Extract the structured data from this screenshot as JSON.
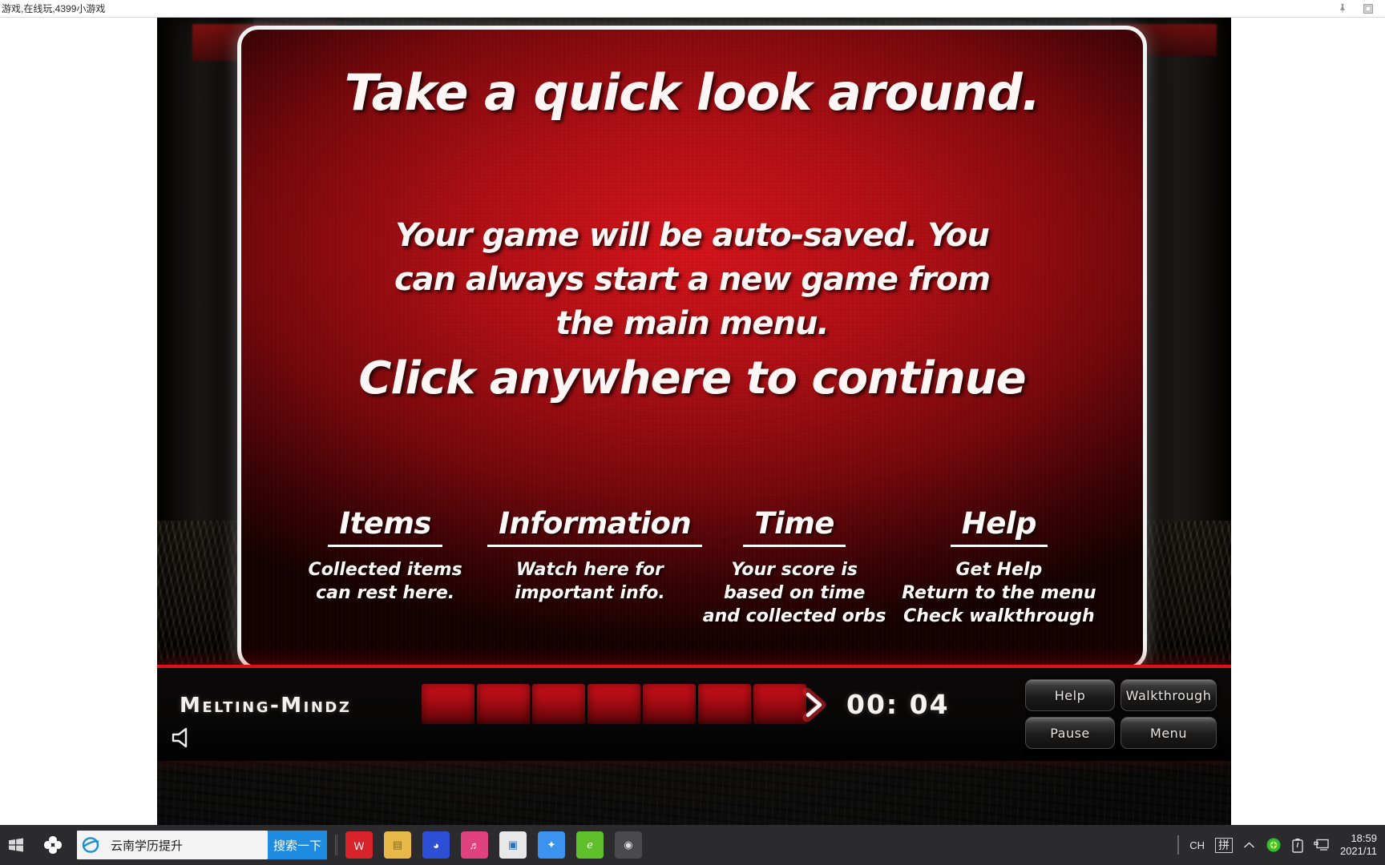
{
  "browser": {
    "title": "游戏,在线玩,4399小游戏",
    "pin_icon": "pin-icon",
    "restore_icon": "restore-icon"
  },
  "dialog": {
    "title": "Take a quick look around.",
    "body": "Your game will be auto-saved. You can always start a new game from the main menu.",
    "cta": "Click anywhere to continue",
    "callouts": [
      {
        "heading": "Items",
        "desc": "Collected items\ncan rest here."
      },
      {
        "heading": "Information",
        "desc": "Watch here for\nimportant info."
      },
      {
        "heading": "Time",
        "desc": "Your score is\nbased on time\nand collected orbs"
      },
      {
        "heading": "Help",
        "desc": "Get Help\nReturn to the menu\nCheck walkthrough"
      }
    ]
  },
  "hud": {
    "logo": "Melting-Mindz",
    "speaker_icon": "speaker-icon",
    "next_arrow_icon": "chevron-right-icon",
    "timer": "00: 04",
    "inventory_slots": 7,
    "buttons": [
      {
        "label": "Help"
      },
      {
        "label": "Walkthrough"
      },
      {
        "label": "Pause"
      },
      {
        "label": "Menu"
      }
    ],
    "accent_color": "#e01018"
  },
  "taskbar": {
    "start_icon": "windows-start-icon",
    "cortana_icon": "cortana-circle-icon",
    "search": {
      "engine_icon": "internet-explorer-icon",
      "value": "云南学历提升",
      "button_label": "搜索一下"
    },
    "apps": [
      {
        "name": "wps-office-icon",
        "glyph": "Ｗ",
        "color": "#d9232b",
        "active": false
      },
      {
        "name": "file-explorer-icon",
        "glyph": "▤",
        "color": "#e8b84b",
        "active": false
      },
      {
        "name": "browser-360-icon",
        "glyph": "◕",
        "color": "#2c4fd6",
        "active": false
      },
      {
        "name": "music-app-icon",
        "glyph": "♬",
        "color": "#e0427e",
        "active": false
      },
      {
        "name": "news-app-icon",
        "glyph": "▣",
        "color": "#e8e8e8",
        "active": false
      },
      {
        "name": "bird-app-icon",
        "glyph": "✦",
        "color": "#3b92ef",
        "active": false
      },
      {
        "name": "green-browser-icon",
        "glyph": "ℯ",
        "color": "#5fc02c",
        "active": false
      },
      {
        "name": "obs-studio-icon",
        "glyph": "◉",
        "color": "#2d2d2d",
        "active": true
      }
    ],
    "tray": {
      "language": "CH",
      "ime": "拼",
      "overflow_icon": "chevron-up-icon",
      "antivirus_icon": "shield-green-icon",
      "battery_icon": "battery-icon",
      "network_icon": "monitor-icon",
      "time": "18:59",
      "date": "2021/11"
    }
  }
}
